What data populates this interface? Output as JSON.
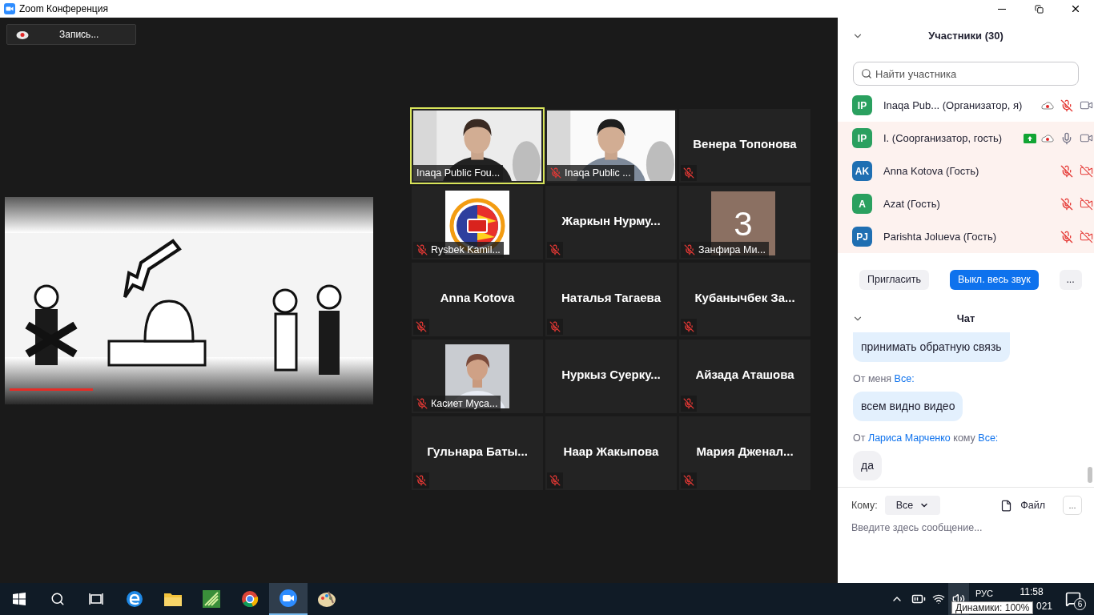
{
  "window": {
    "title": "Zoom Конференция"
  },
  "record_button": {
    "label": "Запись..."
  },
  "gallery": [
    {
      "kind": "video",
      "name": "Inaqa Public Fou...",
      "muted": false,
      "active": true
    },
    {
      "kind": "video",
      "name": "Inaqa Public ...",
      "muted": true,
      "active": false
    },
    {
      "kind": "name",
      "name": "Венера Топонова",
      "muted": true,
      "active": false
    },
    {
      "name": "Rysbek Kamil...",
      "muted": true,
      "active": false
    },
    {
      "kind": "name",
      "name": "Жаркын  Нурму...",
      "muted": true,
      "active": false
    },
    {
      "kind": "initial",
      "avatar": "3",
      "name": "Занфира Ми...",
      "muted": true,
      "active": false
    },
    {
      "kind": "name",
      "name": "Anna Kotova",
      "muted": true,
      "active": false
    },
    {
      "kind": "name",
      "name": "Наталья Тагаева",
      "muted": true,
      "active": false
    },
    {
      "kind": "name",
      "name": "Кубанычбек  За...",
      "muted": true,
      "active": false
    },
    {
      "name": "Касиет Муса...",
      "muted": true,
      "active": false
    },
    {
      "kind": "name",
      "name": "Нуркыз  Суерку...",
      "muted": false,
      "active": false
    },
    {
      "kind": "name",
      "name": "Айзада Аташова",
      "muted": true,
      "active": false
    },
    {
      "kind": "name",
      "name": "Гульнара  Баты...",
      "muted": true,
      "active": false
    },
    {
      "kind": "name",
      "name": "Наар Жакыпова",
      "muted": true,
      "active": false
    },
    {
      "kind": "name",
      "name": "Мария  Дженал...",
      "muted": true,
      "active": false
    }
  ],
  "participants_panel": {
    "title": "Участники (30)",
    "search": {
      "placeholder": "Найти участника"
    },
    "participants": [
      {
        "initials": "IP",
        "color": "#2aa05f",
        "name": "Inaqa Pub... (Организатор, я)",
        "highlighted": false,
        "sharing": false,
        "recording": true,
        "muted": true,
        "video_on": true
      },
      {
        "initials": "IP",
        "color": "#2aa05f",
        "name": "I. (Соорганизатор, гость)",
        "highlighted": true,
        "sharing": true,
        "recording": true,
        "muted": false,
        "video_on": true
      },
      {
        "initials": "AK",
        "color": "#1f6fb2",
        "name": "Anna Kotova (Гость)",
        "highlighted": true,
        "sharing": false,
        "recording": false,
        "muted": true,
        "video_on": false
      },
      {
        "initials": "A",
        "color": "#2aa05f",
        "name": "Azat (Гость)",
        "highlighted": true,
        "sharing": false,
        "recording": false,
        "muted": true,
        "video_on": false
      },
      {
        "initials": "PJ",
        "color": "#1f6fb2",
        "name": "Parishta Jolueva (Гость)",
        "highlighted": true,
        "sharing": false,
        "recording": false,
        "muted": true,
        "video_on": false
      }
    ],
    "buttons": [
      {
        "label": "Пригласить",
        "kind": "secondary"
      },
      {
        "label": "Выкл. весь звук",
        "kind": "primary"
      },
      {
        "label": "...",
        "kind": "more"
      }
    ]
  },
  "chat": {
    "title": "Чат",
    "messages": [
      {
        "text": "принимать обратную связь",
        "mine": true
      },
      {
        "header": [
          {
            "text": "От меня",
            "kind": "plain"
          },
          {
            "text": "Все:",
            "kind": "link"
          }
        ],
        "text": "всем видно видео",
        "mine": true
      },
      {
        "header": [
          {
            "text": "От",
            "kind": "plain"
          },
          {
            "text": "Лариса Марченко",
            "kind": "link"
          },
          {
            "text": "кому",
            "kind": "plain"
          },
          {
            "text": "Все:",
            "kind": "link"
          }
        ],
        "text": "да",
        "mine": false
      }
    ],
    "compose": {
      "to_label": "Кому:",
      "recipient": "Все",
      "file_button": "Файл",
      "more_button": "...",
      "placeholder": "Введите здесь сообщение..."
    }
  },
  "taskbar": {
    "items": [
      {
        "kind": "start",
        "active": false
      },
      {
        "kind": "search",
        "active": false
      },
      {
        "kind": "taskview",
        "active": false
      },
      {
        "kind": "edge",
        "active": false
      },
      {
        "kind": "explorer",
        "active": false
      },
      {
        "kind": "green-app",
        "active": false
      },
      {
        "kind": "chrome",
        "active": false
      },
      {
        "kind": "zoom",
        "active": true
      },
      {
        "kind": "paint",
        "active": false
      }
    ],
    "tray": {
      "language": "РУС",
      "time": "11:58",
      "date": "021",
      "notifications": "6",
      "tooltip": "Динамики: 100%"
    }
  }
}
